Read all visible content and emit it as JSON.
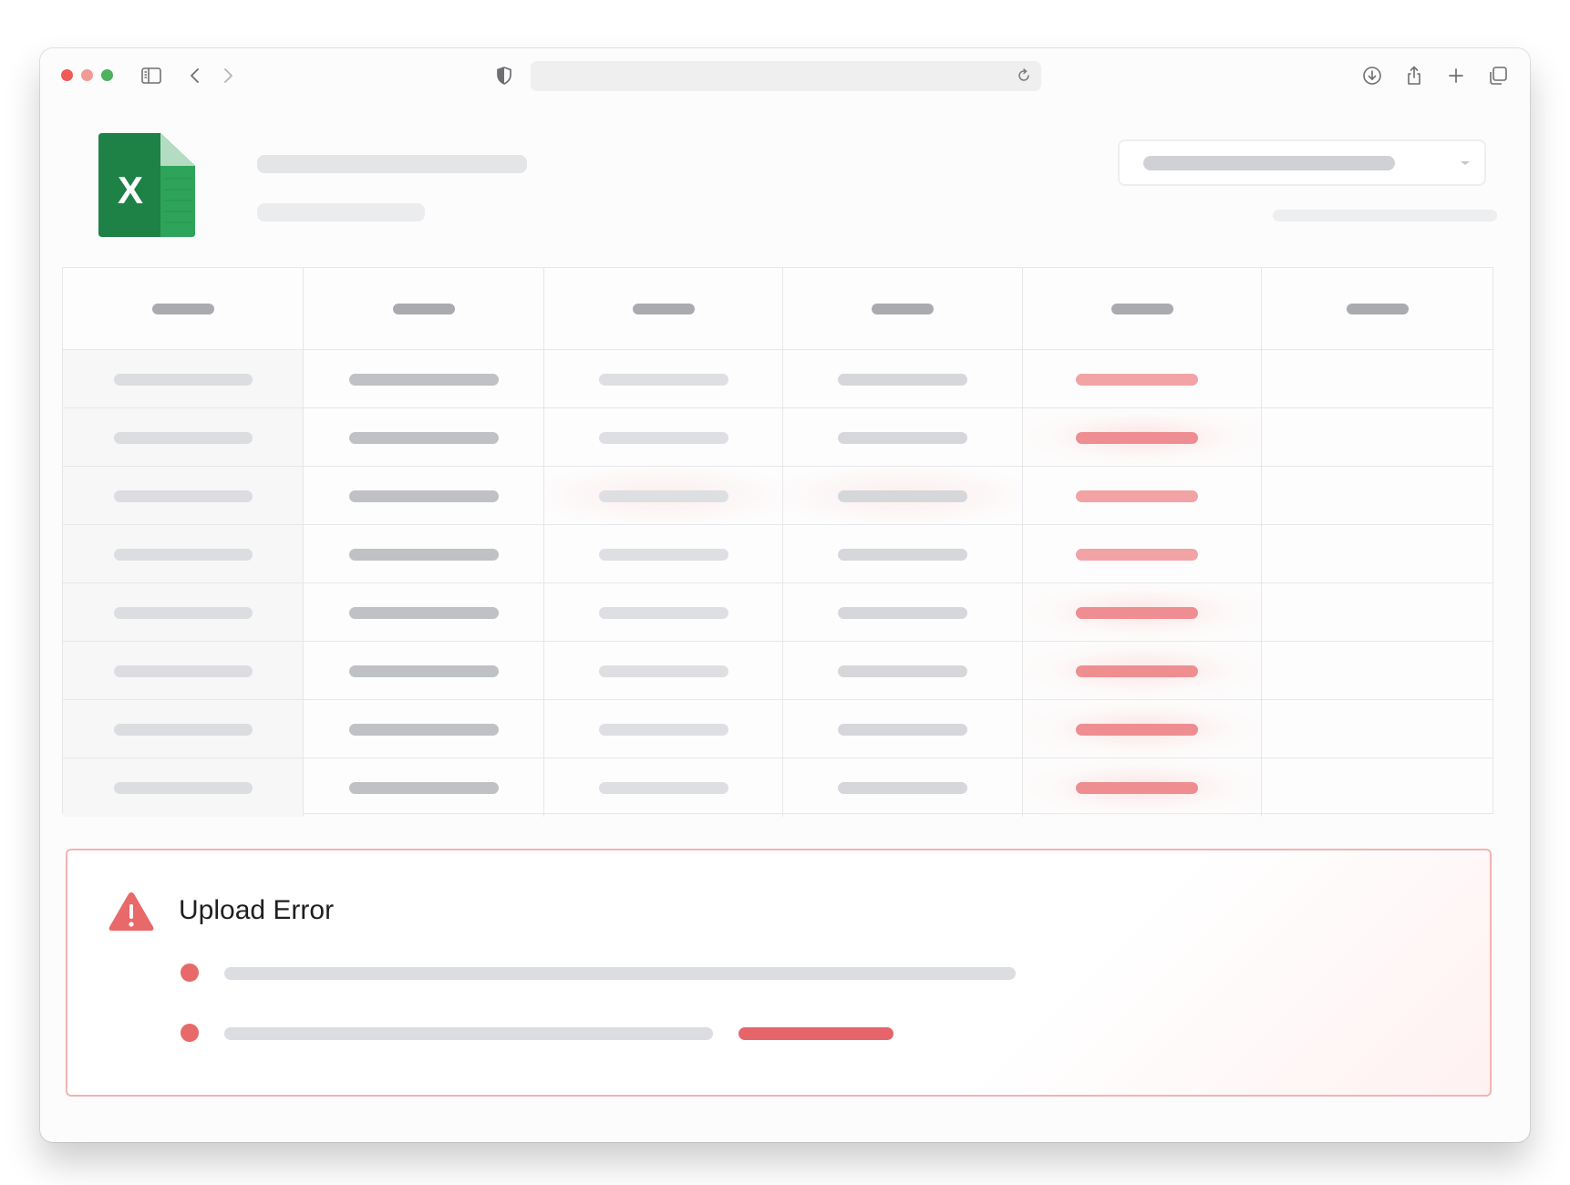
{
  "browser": {
    "traffic_lights": [
      "close",
      "minimize",
      "zoom"
    ],
    "toolbar_icons": [
      "sidebar-icon",
      "back-icon",
      "forward-icon",
      "shield-icon",
      "reload-icon",
      "download-icon",
      "share-icon",
      "new-tab-icon",
      "tabs-overview-icon"
    ],
    "url": ""
  },
  "file": {
    "icon": "excel-icon",
    "letter": "X",
    "brand_color": "#1e8146"
  },
  "table": {
    "columns": 6,
    "rows": 8,
    "error_column": 5
  },
  "error": {
    "title": "Upload Error",
    "icon": "warning-triangle-icon",
    "accent_color": "#e8696a",
    "bullets": 2
  }
}
